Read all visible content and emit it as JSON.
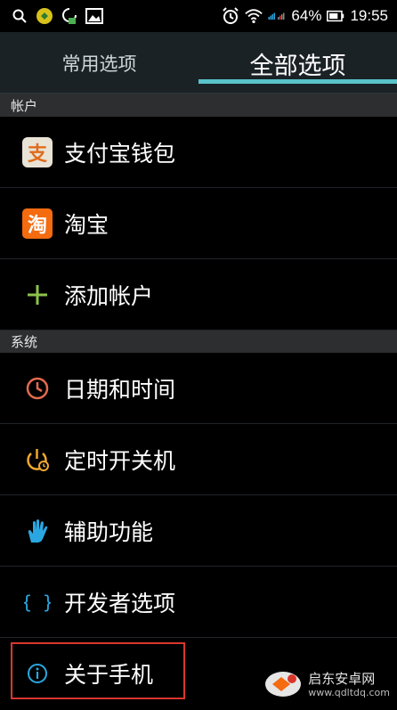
{
  "status_bar": {
    "battery": "64%",
    "time": "19:55",
    "icons": [
      "search-icon",
      "app-icon",
      "sync-icon",
      "image-icon",
      "alarm-icon",
      "wifi-icon",
      "signal-icon",
      "battery-icon"
    ]
  },
  "tabs": [
    {
      "label": "常用选项",
      "active": false
    },
    {
      "label": "全部选项",
      "active": true
    }
  ],
  "sections": {
    "accounts": {
      "title": "帐户",
      "items": [
        {
          "label": "支付宝钱包",
          "icon": "alipay-icon"
        },
        {
          "label": "淘宝",
          "icon": "taobao-icon"
        },
        {
          "label": "添加帐户",
          "icon": "plus-icon"
        }
      ]
    },
    "system": {
      "title": "系统",
      "items": [
        {
          "label": "日期和时间",
          "icon": "clock-icon"
        },
        {
          "label": "定时开关机",
          "icon": "power-timer-icon"
        },
        {
          "label": "辅助功能",
          "icon": "hand-icon"
        },
        {
          "label": "开发者选项",
          "icon": "braces-icon"
        },
        {
          "label": "关于手机",
          "icon": "info-icon"
        }
      ]
    }
  },
  "watermark": {
    "name": "启东安卓网",
    "url": "www.qdltdq.com"
  },
  "colors": {
    "accent": "#58c3c9",
    "highlight": "#d9362b"
  }
}
